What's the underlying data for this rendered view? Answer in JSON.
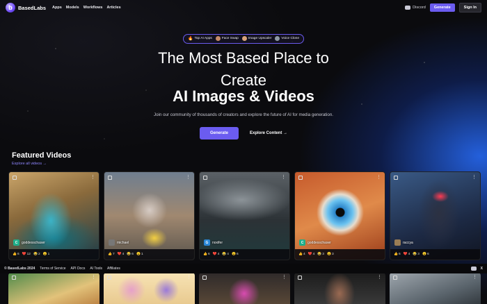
{
  "brand": {
    "name": "BasedLabs",
    "accent": "#6b5cf0",
    "glow": "#2b6dff"
  },
  "nav": {
    "links": [
      "Apps",
      "Models",
      "Workflows",
      "Articles"
    ],
    "discord": "Discord",
    "generate": "Generate",
    "sign_in": "Sign In"
  },
  "pills": [
    {
      "label": "Top AI Apps",
      "icon": "fire-icon"
    },
    {
      "label": "Face Swap",
      "icon": "face-swap-thumb"
    },
    {
      "label": "Image Upscaler",
      "icon": "upscaler-thumb"
    },
    {
      "label": "Voice Clone",
      "icon": "voice-clone-thumb"
    }
  ],
  "hero": {
    "title_line1": "The Most Based Place to",
    "title_line2": "Create",
    "title_line3": "AI Images & Videos",
    "subtitle": "Join our community of thousands of creators and explore the future of AI for media generation.",
    "generate": "Generate",
    "explore": "Explore Content →"
  },
  "featured": {
    "title": "Featured Videos",
    "link": "Explore all videos →",
    "cards": [
      {
        "user": "goddesschaser",
        "avatar_letter": "C",
        "avatar_color": "#1fae8a",
        "reactions": [
          {
            "emoji": "👍",
            "count": "6"
          },
          {
            "emoji": "❤️",
            "count": "12"
          },
          {
            "emoji": "😂",
            "count": "2"
          },
          {
            "emoji": "😮",
            "count": "1"
          }
        ]
      },
      {
        "user": "michael",
        "avatar_letter": "",
        "avatar_color": "#777777",
        "reactions": [
          {
            "emoji": "👍",
            "count": "7"
          },
          {
            "emoji": "❤️",
            "count": "4"
          },
          {
            "emoji": "😂",
            "count": "6"
          },
          {
            "emoji": "😮",
            "count": "1"
          }
        ]
      },
      {
        "user": "noxifer",
        "avatar_letter": "G",
        "avatar_color": "#2a88d8",
        "reactions": [
          {
            "emoji": "👍",
            "count": "6"
          },
          {
            "emoji": "❤️",
            "count": "4"
          },
          {
            "emoji": "😂",
            "count": "4"
          },
          {
            "emoji": "😮",
            "count": "6"
          }
        ]
      },
      {
        "user": "goddesschaser",
        "avatar_letter": "C",
        "avatar_color": "#1fae8a",
        "reactions": [
          {
            "emoji": "👍",
            "count": "4"
          },
          {
            "emoji": "❤️",
            "count": "4"
          },
          {
            "emoji": "😂",
            "count": "3"
          },
          {
            "emoji": "😮",
            "count": "3"
          }
        ]
      },
      {
        "user": "raccya",
        "avatar_letter": "",
        "avatar_color": "#9a7d55",
        "reactions": [
          {
            "emoji": "👍",
            "count": "6"
          },
          {
            "emoji": "❤️",
            "count": "4"
          },
          {
            "emoji": "😂",
            "count": "3"
          },
          {
            "emoji": "😮",
            "count": "6"
          }
        ]
      }
    ]
  },
  "footer": {
    "copyright": "© BasedLabs 2024",
    "links": [
      "Terms of Service",
      "API Docs",
      "AI Tools",
      "Affiliates"
    ]
  }
}
